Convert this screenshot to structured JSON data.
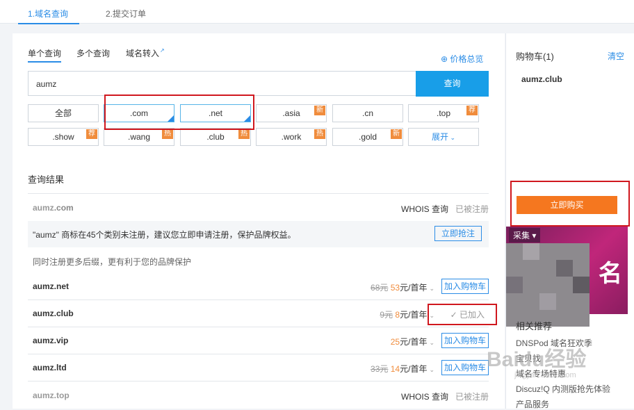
{
  "steps": {
    "step1": "1.域名查询",
    "step2": "2.提交订单"
  },
  "tabs": {
    "single": "单个查询",
    "multi": "多个查询",
    "transfer": "域名转入"
  },
  "price_total": "价格总览",
  "search": {
    "value": "aumz",
    "button": "查询"
  },
  "tlds": [
    {
      "label": "全部",
      "badge": ""
    },
    {
      "label": ".com",
      "badge": ""
    },
    {
      "label": ".net",
      "badge": ""
    },
    {
      "label": ".asia",
      "badge": "新"
    },
    {
      "label": ".cn",
      "badge": ""
    },
    {
      "label": ".top",
      "badge": "荐"
    },
    {
      "label": ".show",
      "badge": "荐"
    },
    {
      "label": ".wang",
      "badge": "热"
    },
    {
      "label": ".club",
      "badge": "热"
    },
    {
      "label": ".work",
      "badge": "热"
    },
    {
      "label": ".gold",
      "badge": "新"
    },
    {
      "label": "展开",
      "badge": ""
    }
  ],
  "results_title": "查询结果",
  "results": {
    "com": {
      "name_prefix": "aumz",
      "name_suffix": ".com",
      "whois": "WHOIS 查询",
      "status": "已被注册"
    },
    "notice": {
      "text": "\"aumz\" 商标在45个类别未注册，建议您立即申请注册，保护品牌权益。",
      "button": "立即抢注"
    },
    "suggest": "同时注册更多后缀，更有利于您的品牌保护",
    "net": {
      "name": "aumz.net",
      "old_price": "68元",
      "price": "53",
      "unit": "元/首年",
      "button": "加入购物车"
    },
    "club": {
      "name": "aumz.club",
      "old_price": "9元",
      "price": "8",
      "unit": "元/首年",
      "added": "已加入"
    },
    "vip": {
      "name": "aumz.vip",
      "price": "25",
      "unit": "元/首年",
      "button": "加入购物车"
    },
    "ltd": {
      "name": "aumz.ltd",
      "old_price": "33元",
      "price": "14",
      "unit": "元/首年",
      "button": "加入购物车"
    },
    "top": {
      "name": "aumz.top",
      "whois": "WHOIS 查询",
      "status": "已被注册"
    }
  },
  "cart": {
    "title": "购物车(1)",
    "clear": "清空",
    "item": "aumz.club",
    "buy": "立即购买"
  },
  "promo": {
    "tag": "采集",
    "big": "名"
  },
  "related": {
    "title": "相关推荐",
    "items": [
      "DNSPod 域名狂欢季",
      "宝贝找",
      "域名专场特惠",
      "Discuz!Q 内测版抢先体验",
      "产品服务"
    ]
  },
  "watermark": {
    "main": "Baidu经验",
    "sub": "jingyan.baidu.com"
  },
  "colors": {
    "accent": "#2a8ce6",
    "button_blue": "#189ee8",
    "orange": "#f5771f",
    "highlight_red": "#d0171e"
  }
}
